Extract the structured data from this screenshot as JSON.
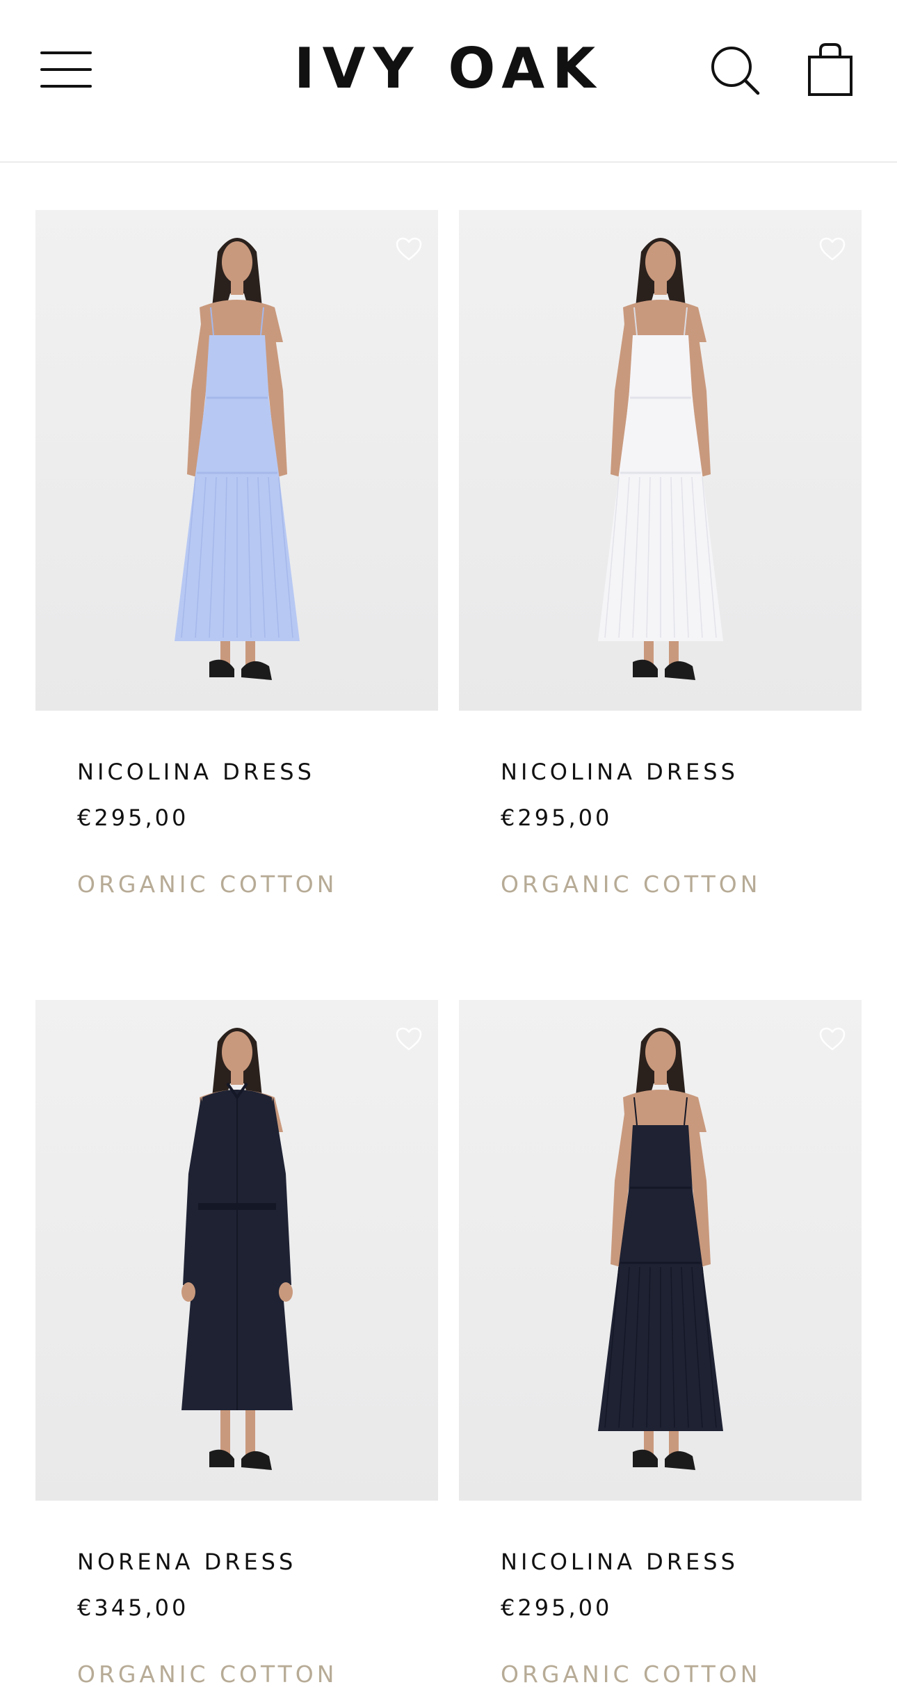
{
  "header": {
    "logo_text": "IVY OAK",
    "icons": {
      "menu": "hamburger-menu-icon",
      "search": "search-icon",
      "cart": "shopping-bag-icon"
    }
  },
  "colors": {
    "tag_text": "#b7ab96",
    "divider": "#ececec",
    "image_background": "#efefef"
  },
  "products": [
    {
      "name": "NICOLINA DRESS",
      "price": "€295,00",
      "tag": "ORGANIC COTTON",
      "dress_color": "#b7c8f3",
      "style": "slip-dress",
      "wishlist_icon": "heart-outline-icon"
    },
    {
      "name": "NICOLINA DRESS",
      "price": "€295,00",
      "tag": "ORGANIC COTTON",
      "dress_color": "#f5f5f8",
      "style": "slip-dress",
      "wishlist_icon": "heart-outline-icon"
    },
    {
      "name": "NORENA DRESS",
      "price": "€345,00",
      "tag": "ORGANIC COTTON",
      "dress_color": "#1e2233",
      "style": "shirt-dress",
      "wishlist_icon": "heart-outline-icon"
    },
    {
      "name": "NICOLINA DRESS",
      "price": "€295,00",
      "tag": "ORGANIC COTTON",
      "dress_color": "#1e2233",
      "style": "slip-dress",
      "wishlist_icon": "heart-outline-icon"
    }
  ]
}
